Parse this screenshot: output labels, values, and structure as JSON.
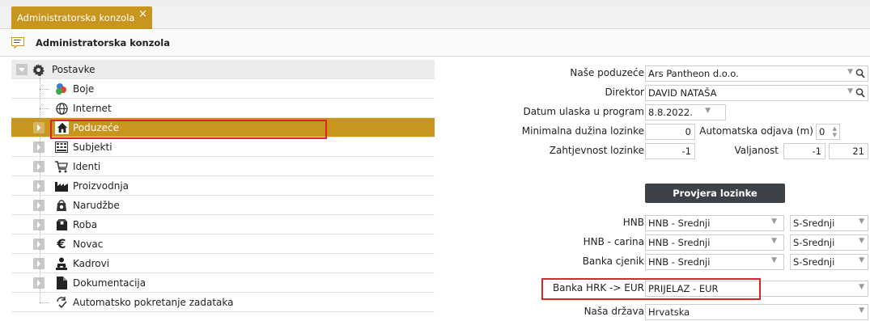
{
  "tabs": [
    {
      "label": "Administratorska konzola",
      "close": "×"
    }
  ],
  "window": {
    "title": "Administratorska konzola"
  },
  "tree": {
    "root": "Postavke",
    "items": [
      {
        "label": "Boje"
      },
      {
        "label": "Internet"
      },
      {
        "label": "Poduzeće"
      },
      {
        "label": "Subjekti"
      },
      {
        "label": "Identi"
      },
      {
        "label": "Proizvodnja"
      },
      {
        "label": "Narudžbe"
      },
      {
        "label": "Roba"
      },
      {
        "label": "Novac"
      },
      {
        "label": "Kadrovi"
      },
      {
        "label": "Dokumentacija"
      },
      {
        "label": "Automatsko pokretanje zadataka"
      }
    ]
  },
  "form": {
    "nase_poduzece": {
      "label": "Naše poduzeće",
      "value": "Ars Pantheon d.o.o."
    },
    "direktor": {
      "label": "Direktor",
      "value": "DAVID NATAŠA"
    },
    "datum_ulaska": {
      "label": "Datum ulaska u program",
      "value": "8.8.2022."
    },
    "min_duzina": {
      "label": "Minimalna dužina lozinke",
      "value": "0"
    },
    "auto_odjava": {
      "label": "Automatska odjava (m)",
      "value": "0"
    },
    "zahtjevnost": {
      "label": "Zahtjevnost lozinke",
      "value": "-1"
    },
    "valjanost": {
      "label": "Valjanost",
      "value": "-1",
      "value2": "21"
    },
    "provjera_button": "Provjera lozinke",
    "hnb": {
      "label": "HNB",
      "value": "HNB - Srednji",
      "value2": "S-Srednji"
    },
    "hnb_carina": {
      "label": "HNB - carina",
      "value": "HNB - Srednji",
      "value2": "S-Srednji"
    },
    "banka_cjenik": {
      "label": "Banka cjenik",
      "value": "HNB - Srednji",
      "value2": "S-Srednji"
    },
    "banka_hrk_eur": {
      "label": "Banka HRK -> EUR",
      "value": "PRIJELAZ - EUR"
    },
    "nasa_drzava": {
      "label": "Naša država",
      "value": "Hrvatska"
    }
  },
  "colors": {
    "accent": "#c8961e",
    "highlight": "#d9262c",
    "button": "#3d4248"
  }
}
